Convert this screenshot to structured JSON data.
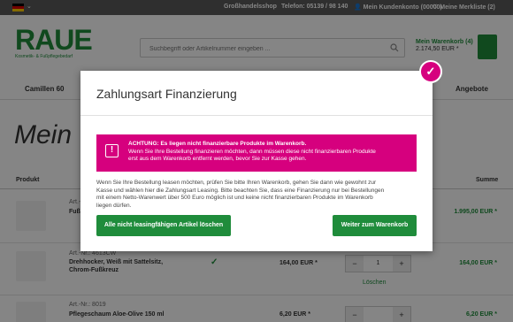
{
  "topbar": {
    "flag_colors": [
      "#000000",
      "#dd0000",
      "#ffce00"
    ],
    "items": [
      "Großhandelsshop",
      "Telefon: 05139 / 98 140",
      "Mein Kundenkonto (00000)",
      "Meine Merkliste (2)"
    ]
  },
  "header": {
    "logo_text": "RAUE",
    "logo_tagline": "Kosmetik- & Fußpflegebedarf",
    "search_placeholder": "Suchbegriff oder Artikelnummer eingeben ...",
    "cart_label": "Mein Warenkorb (4)",
    "cart_amount": "2.174,50 EUR *",
    "accent_color": "#1f8c3b"
  },
  "nav": {
    "items": [
      "Camillen 60",
      "Angebote"
    ]
  },
  "page": {
    "title": "Mein W"
  },
  "table": {
    "headers": [
      "Produkt",
      "Summe"
    ],
    "rows": [
      {
        "art": "Art.-...",
        "name": "Fuß...",
        "total": "1.995,00 EUR *"
      },
      {
        "art": "Art.-Nr.: 4613CW",
        "name1": "Drehhocker, Weiß mit Sattelsitz,",
        "name2": "Chrom-Fußkreuz",
        "check": "✓",
        "price": "164,00 EUR *",
        "qty": "1",
        "total": "164,00 EUR *",
        "remove": "Löschen"
      },
      {
        "art": "Art.-Nr.: 8019",
        "name1": "Pflegeschaum Aloe-Olive 150 ml",
        "price": "6,20 EUR *",
        "total": "6,20 EUR *"
      }
    ]
  },
  "modal": {
    "title": "Zahlungsart Finanzierung",
    "alert_head": "ACHTUNG: Es liegen nicht finanzierbare Produkte im Warenkorb.",
    "alert_line1": "Wenn Sie Ihre Bestellung finanzieren möchten, dann müssen diese nicht finanzierbaren Produkte",
    "alert_line2": "erst aus dem Warenkorb entfernt werden, bevor Sie zur Kasse gehen.",
    "body_line1": "Wenn Sie Ihre Bestellung leasen möchten, prüfen Sie bitte Ihren Warenkorb, gehen Sie dann wie gewohnt zur",
    "body_line2": "Kasse und wählen hier die Zahlungsart Leasing. Bitte beachten Sie, dass eine Finanzierung nur bei Bestellungen",
    "body_line3": "mit einem Netto-Warenwert über 500 Euro möglich ist und keine nicht finanzierbaren Produkte im Warenkorb",
    "body_line4": "liegen dürfen.",
    "btn_delete": "Alle nicht leasingfähigen Artikel löschen",
    "btn_cart": "Weiter zum Warenkorb",
    "alert_color": "#d6007e"
  }
}
